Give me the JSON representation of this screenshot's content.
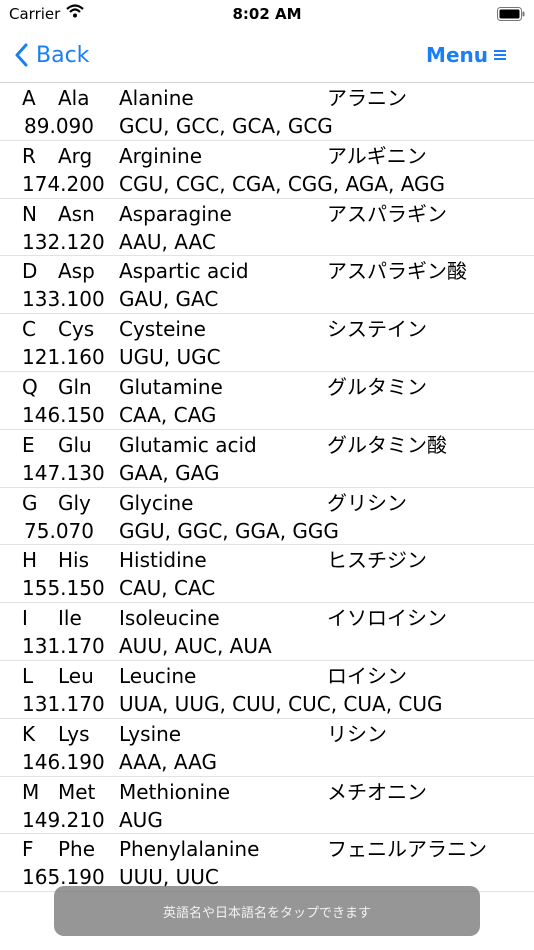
{
  "status_bar": {
    "carrier": "Carrier",
    "time": "8:02 AM"
  },
  "nav": {
    "back_label": "Back",
    "menu_label": "Menu"
  },
  "amino_acids": [
    {
      "one": "A",
      "three": "Ala",
      "english": "Alanine",
      "japanese": "アラニン",
      "mass": "89.090",
      "codons": "GCU, GCC, GCA, GCG"
    },
    {
      "one": "R",
      "three": "Arg",
      "english": "Arginine",
      "japanese": "アルギニン",
      "mass": "174.200",
      "codons": "CGU, CGC, CGA, CGG, AGA, AGG"
    },
    {
      "one": "N",
      "three": "Asn",
      "english": "Asparagine",
      "japanese": "アスパラギン",
      "mass": "132.120",
      "codons": "AAU, AAC"
    },
    {
      "one": "D",
      "three": "Asp",
      "english": "Aspartic acid",
      "japanese": "アスパラギン酸",
      "mass": "133.100",
      "codons": "GAU, GAC"
    },
    {
      "one": "C",
      "three": "Cys",
      "english": "Cysteine",
      "japanese": "システイン",
      "mass": "121.160",
      "codons": "UGU, UGC"
    },
    {
      "one": "Q",
      "three": "Gln",
      "english": "Glutamine",
      "japanese": "グルタミン",
      "mass": "146.150",
      "codons": "CAA, CAG"
    },
    {
      "one": "E",
      "three": "Glu",
      "english": "Glutamic acid",
      "japanese": "グルタミン酸",
      "mass": "147.130",
      "codons": "GAA, GAG"
    },
    {
      "one": "G",
      "three": "Gly",
      "english": "Glycine",
      "japanese": "グリシン",
      "mass": "75.070",
      "codons": "GGU, GGC, GGA, GGG"
    },
    {
      "one": "H",
      "three": "His",
      "english": "Histidine",
      "japanese": "ヒスチジン",
      "mass": "155.150",
      "codons": "CAU, CAC"
    },
    {
      "one": "I",
      "three": "Ile",
      "english": "Isoleucine",
      "japanese": "イソロイシン",
      "mass": "131.170",
      "codons": "AUU, AUC, AUA"
    },
    {
      "one": "L",
      "three": "Leu",
      "english": "Leucine",
      "japanese": "ロイシン",
      "mass": "131.170",
      "codons": "UUA, UUG, CUU, CUC, CUA, CUG"
    },
    {
      "one": "K",
      "three": "Lys",
      "english": "Lysine",
      "japanese": "リシン",
      "mass": "146.190",
      "codons": "AAA, AAG"
    },
    {
      "one": "M",
      "three": "Met",
      "english": "Methionine",
      "japanese": "メチオニン",
      "mass": "149.210",
      "codons": "AUG"
    },
    {
      "one": "F",
      "three": "Phe",
      "english": "Phenylalanine",
      "japanese": "フェニルアラニン",
      "mass": "165.190",
      "codons": "UUU, UUC"
    }
  ],
  "toast": {
    "text": "英語名や日本語名をタップできます"
  }
}
